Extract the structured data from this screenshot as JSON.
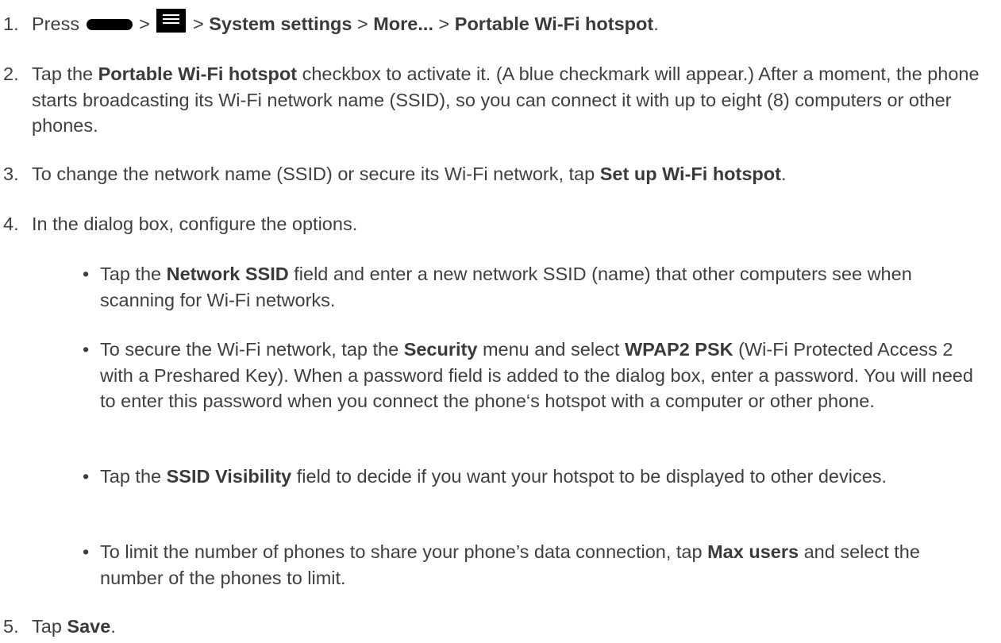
{
  "steps": [
    {
      "number": "1.",
      "parts": {
        "press": "Press",
        "sep1": ">",
        "sep2": ">",
        "system_settings": "System settings",
        "sep3": ">",
        "more": "More...",
        "sep4": ">",
        "portable_hotspot": "Portable Wi-Fi hotspot",
        "end": "."
      },
      "icons": [
        "home-key-icon",
        "menu-icon"
      ]
    },
    {
      "number": "2.",
      "parts": {
        "a": "Tap the",
        "bold": "Portable Wi-Fi hotspot",
        "b": "checkbox to activate it. (A blue checkmark will appear.) After a moment, the phone starts broadcasting its Wi-Fi network name (SSID), so you can connect it with up to eight (8) computers or other phones."
      }
    },
    {
      "number": "3.",
      "parts": {
        "a": "To change the network name (SSID) or secure its Wi-Fi network, tap",
        "bold": "Set up Wi-Fi hotspot",
        "b": "."
      }
    },
    {
      "number": "4.",
      "parts": {
        "a": "In the dialog box, configure the options."
      }
    },
    {
      "number": "5.",
      "parts": {
        "a": "Tap",
        "bold": "Save",
        "b": "."
      }
    }
  ],
  "bullets": [
    {
      "dot": "•",
      "a": "Tap the",
      "bold": "Network SSID",
      "b": "field and enter a new network SSID (name) that other computers see when scanning for Wi-Fi networks."
    },
    {
      "dot": "•",
      "a": "To secure the Wi-Fi network, tap the",
      "bold": "Security",
      "b": "menu and select",
      "bold2": "WPAP2 PSK",
      "c": "(Wi-Fi Protected Access 2 with a Preshared Key). When a password field is added to the dialog box, enter a password. You will need to enter this password when you connect the phone‘s hotspot with a computer or other phone."
    },
    {
      "dot": "•",
      "a": "Tap the",
      "bold": "SSID Visibility",
      "b": "field to decide if you want your hotspot to be displayed to other devices."
    },
    {
      "dot": "•",
      "a": "To limit the number of phones to share your phone’s data connection, tap",
      "bold": "Max users",
      "b": "and select the number of the phones to limit."
    }
  ]
}
